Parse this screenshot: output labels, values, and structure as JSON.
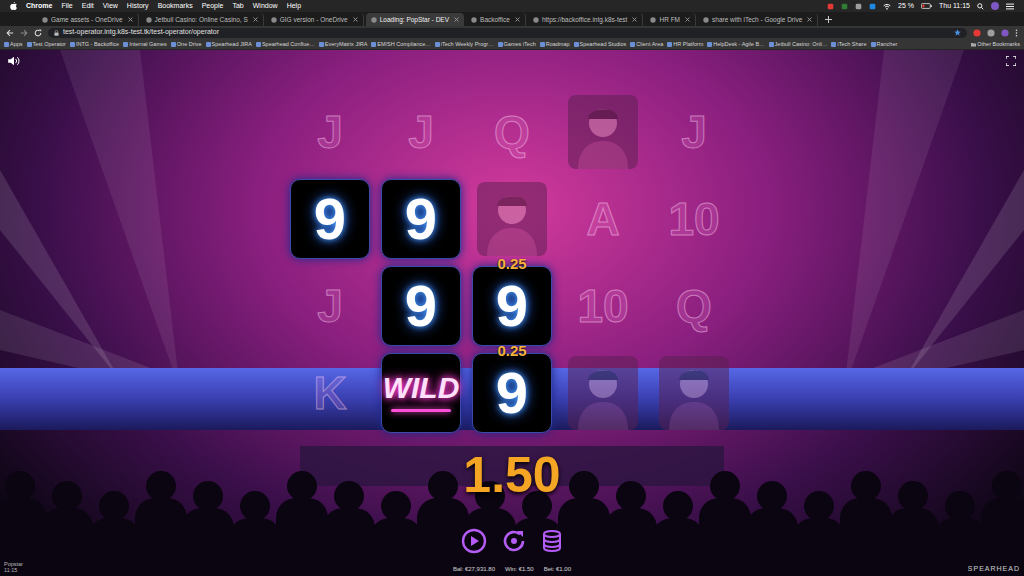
{
  "menubar": {
    "app": "Chrome",
    "items": [
      "File",
      "Edit",
      "View",
      "History",
      "Bookmarks",
      "People",
      "Tab",
      "Window",
      "Help"
    ],
    "battery": "25 %",
    "clock": "Thu 11:15"
  },
  "tabs": [
    {
      "label": "Game assets - OneDrive",
      "selected": false
    },
    {
      "label": "Jetbull Casino: Online Casino, S",
      "selected": false
    },
    {
      "label": "GIG version - OneDrive",
      "selected": false
    },
    {
      "label": "Loading: PopStar - DEV",
      "selected": true
    },
    {
      "label": "Backoffice",
      "selected": false
    },
    {
      "label": "https://backoffice.intg.k8s-test",
      "selected": false
    },
    {
      "label": "HR FM",
      "selected": false
    },
    {
      "label": "share with iTech - Google Drive",
      "selected": false
    }
  ],
  "address": {
    "url": "test-operator.intg.k8s-test.tk/test-operator/operator"
  },
  "bookmarks": [
    "Apps",
    "Test Operator",
    "INTG - Backoffice",
    "Internal Games",
    "One Drive",
    "Spearhead JIRA",
    "Spearhead Confluе…",
    "EveryMatrix JIRA",
    "EM/SH Compliance…",
    "iTech Weekly Progr…",
    "Games iTech",
    "Roadmap",
    "Spearhead Studios",
    "Client Area",
    "HR Platform",
    "HelpDesk - Agile B…",
    "Jetbull Casino: Onli…",
    "iTech Share",
    "Rancher"
  ],
  "other_bookmarks": "Other Bookmarks",
  "reels": {
    "rows": [
      [
        {
          "kind": "letter",
          "symbol": "J",
          "win": false
        },
        {
          "kind": "letter",
          "symbol": "J",
          "win": false
        },
        {
          "kind": "letter",
          "symbol": "Q",
          "win": false
        },
        {
          "kind": "portrait",
          "win": false
        },
        {
          "kind": "letter",
          "symbol": "J",
          "win": false
        }
      ],
      [
        {
          "kind": "letter",
          "symbol": "9",
          "win": true
        },
        {
          "kind": "letter",
          "symbol": "9",
          "win": true
        },
        {
          "kind": "portrait",
          "win": false
        },
        {
          "kind": "letter",
          "symbol": "A",
          "win": false
        },
        {
          "kind": "letter",
          "symbol": "10",
          "win": false
        }
      ],
      [
        {
          "kind": "letter",
          "symbol": "J",
          "win": false
        },
        {
          "kind": "letter",
          "symbol": "9",
          "win": true
        },
        {
          "kind": "letter",
          "symbol": "9",
          "win": true,
          "payout": "0.25"
        },
        {
          "kind": "letter",
          "symbol": "10",
          "win": false
        },
        {
          "kind": "letter",
          "symbol": "Q",
          "win": false
        }
      ],
      [
        {
          "kind": "letter",
          "symbol": "K",
          "win": false
        },
        {
          "kind": "wild",
          "symbol": "WILD",
          "win": true
        },
        {
          "kind": "letter",
          "symbol": "9",
          "win": true,
          "payout": "0.25"
        },
        {
          "kind": "portrait",
          "win": false
        },
        {
          "kind": "portrait",
          "win": false
        }
      ]
    ]
  },
  "win": {
    "amount": "1.50"
  },
  "footer": {
    "game": "Popstar",
    "time": "11:15",
    "balance": "Bal: €27,931.80",
    "win": "Win: €1.50",
    "bet": "Bet: €1.00",
    "brand": "SPEARHEAD"
  }
}
